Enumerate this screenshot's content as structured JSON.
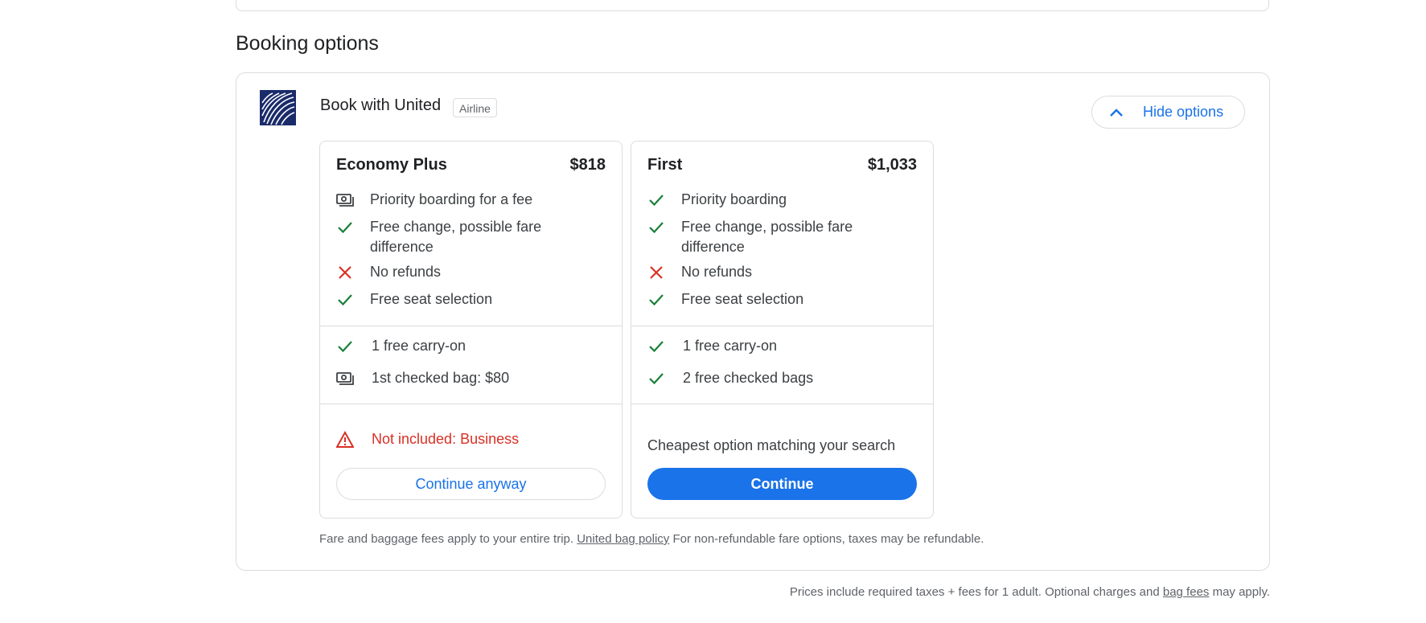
{
  "section_title": "Booking options",
  "provider": {
    "name": "Book with United",
    "chip": "Airline",
    "logo_icon": "united-globe-logo",
    "logo_color": "#1a2b6b",
    "toggle_label": "Hide options",
    "toggle_icon": "chevron-up-icon"
  },
  "fares": [
    {
      "name": "Economy Plus",
      "price": "$818",
      "features": [
        {
          "icon": "money-icon",
          "text": "Priority boarding for a fee"
        },
        {
          "icon": "check-icon",
          "text": "Free change, possible fare difference"
        },
        {
          "icon": "cross-icon",
          "text": "No refunds"
        },
        {
          "icon": "check-icon",
          "text": "Free seat selection"
        }
      ],
      "bags": [
        {
          "icon": "check-icon",
          "text": "1 free carry-on"
        },
        {
          "icon": "money-icon",
          "text": "1st checked bag: $80"
        }
      ],
      "warning": "Not included: Business",
      "button": "Continue anyway"
    },
    {
      "name": "First",
      "price": "$1,033",
      "features": [
        {
          "icon": "check-icon",
          "text": "Priority boarding"
        },
        {
          "icon": "check-icon",
          "text": "Free change, possible fare difference"
        },
        {
          "icon": "cross-icon",
          "text": "No refunds"
        },
        {
          "icon": "check-icon",
          "text": "Free seat selection"
        }
      ],
      "bags": [
        {
          "icon": "check-icon",
          "text": "1 free carry-on"
        },
        {
          "icon": "check-icon",
          "text": "2 free checked bags"
        }
      ],
      "note": "Cheapest option matching your search",
      "button": "Continue"
    }
  ],
  "fee_note": {
    "before": "Fare and baggage fees apply to your entire trip.",
    "link": "United bag policy",
    "after": "For non-refundable fare options, taxes may be refundable."
  },
  "price_note": {
    "before": "Prices include required taxes + fees for 1 adult. Optional charges and",
    "link": "bag fees",
    "after": "may apply."
  },
  "colors": {
    "accent": "#1a73e8",
    "check": "#188038",
    "cross": "#d93025",
    "warning": "#d93025",
    "border": "#dadce0"
  }
}
